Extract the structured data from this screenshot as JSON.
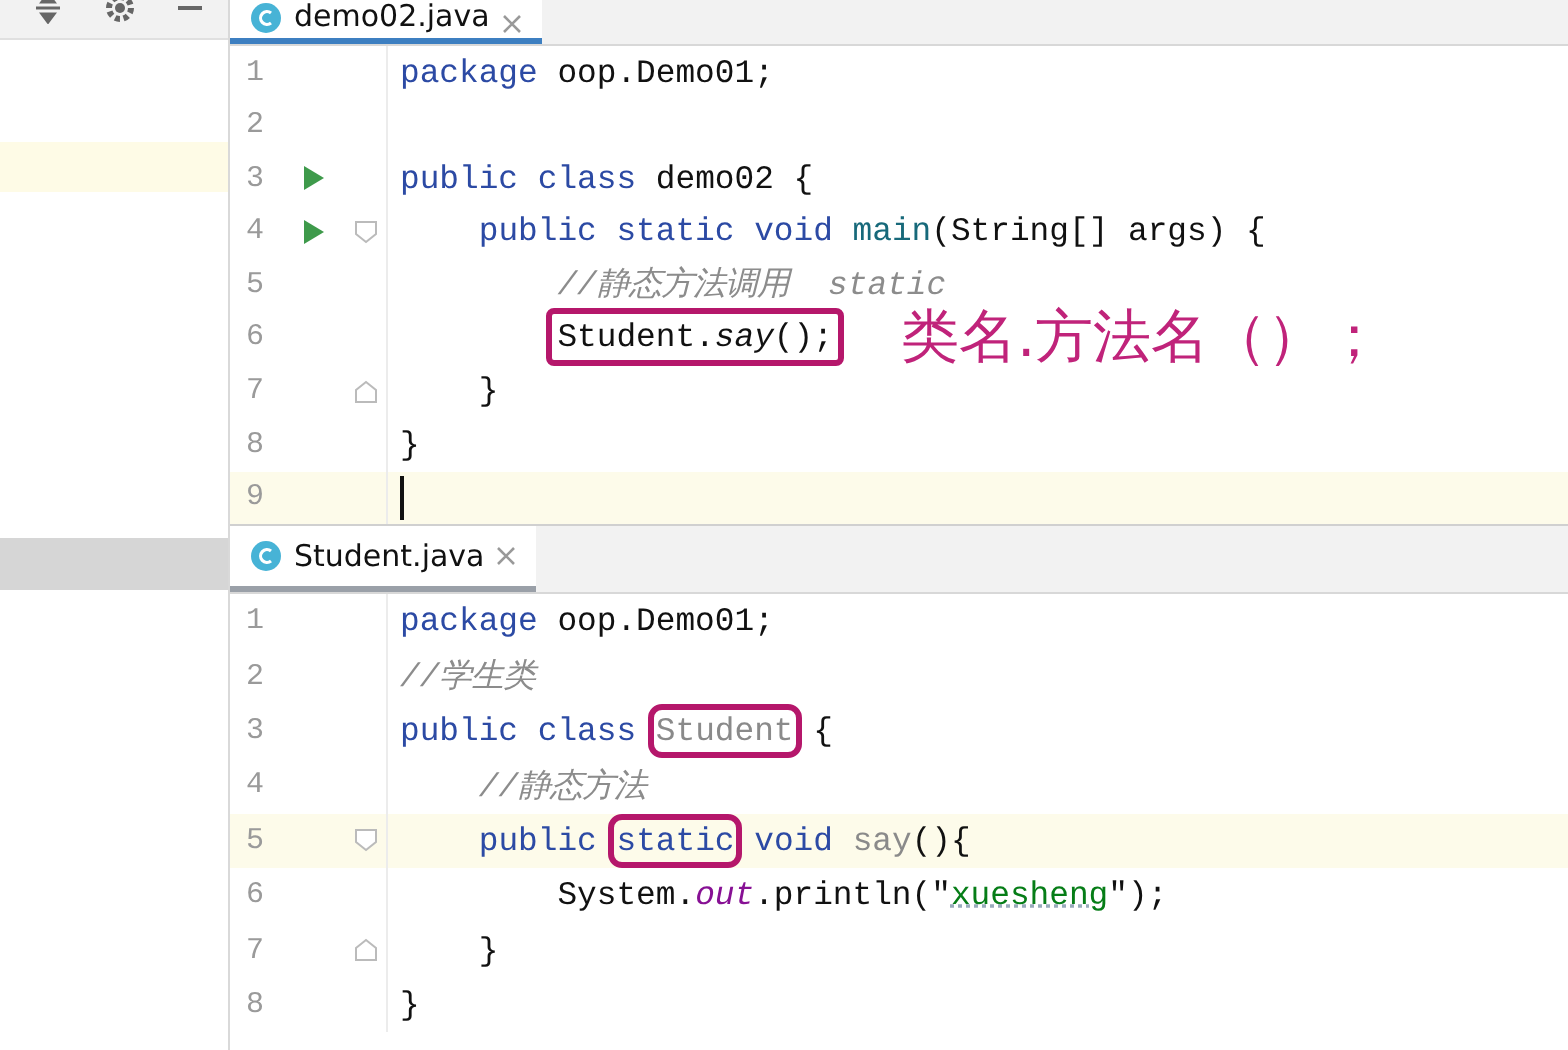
{
  "editors": [
    {
      "tab": {
        "label": "demo02.java",
        "selected": true
      },
      "lines": [
        {
          "number": "1",
          "tokens": [
            {
              "kind": "keyword",
              "text": "package"
            },
            {
              "kind": "plain",
              "text": " oop.Demo01;"
            }
          ]
        },
        {
          "number": "2"
        },
        {
          "number": "3",
          "run": true,
          "tokens": [
            {
              "kind": "keyword",
              "text": "public class"
            },
            {
              "kind": "plain",
              "text": " demo02 {"
            }
          ]
        },
        {
          "number": "4",
          "run": true,
          "fold_start": true,
          "tokens": [
            {
              "kind": "keyword",
              "text": "    public static void"
            },
            {
              "kind": "method",
              "text": " main"
            },
            {
              "kind": "plain",
              "text": "(String[] args) {"
            }
          ]
        },
        {
          "number": "5",
          "tokens": [
            {
              "kind": "comment",
              "text": "        //静态方法调用  static"
            }
          ]
        },
        {
          "number": "6",
          "tokens": [
            {
              "kind": "frame",
              "tokens": [
                {
                  "kind": "plain",
                  "text": "        Student."
                },
                {
                  "kind": "static-call",
                  "text": "say"
                },
                {
                  "kind": "plain",
                  "text": "();"
                }
              ]
            }
          ],
          "note": "类名.方法名（）；"
        },
        {
          "number": "7",
          "fold_end": true,
          "tokens": [
            {
              "kind": "plain",
              "text": "    }"
            }
          ]
        },
        {
          "number": "8",
          "tokens": [
            {
              "kind": "plain",
              "text": "}"
            }
          ]
        },
        {
          "number": "9",
          "current": true,
          "caret": true
        }
      ]
    },
    {
      "tab": {
        "label": "Student.java",
        "selected": false
      },
      "lines": [
        {
          "number": "1",
          "tokens": [
            {
              "kind": "keyword",
              "text": "package"
            },
            {
              "kind": "plain",
              "text": " oop.Demo01;"
            }
          ]
        },
        {
          "number": "2",
          "tokens": [
            {
              "kind": "comment",
              "text": "//学生类"
            }
          ]
        },
        {
          "number": "3",
          "tokens": [
            {
              "kind": "keyword",
              "text": "public class"
            },
            {
              "kind": "unused",
              "text": " Student",
              "boxed": true
            },
            {
              "kind": "plain",
              "text": " {"
            }
          ]
        },
        {
          "number": "4",
          "tokens": [
            {
              "kind": "comment",
              "text": "    //静态方法"
            }
          ]
        },
        {
          "number": "5",
          "current": true,
          "fold_start": true,
          "tokens": [
            {
              "kind": "keyword",
              "text": "    public"
            },
            {
              "kind": "keyword",
              "text": " static",
              "boxed": true
            },
            {
              "kind": "keyword",
              "text": " void"
            },
            {
              "kind": "unused",
              "text": " say"
            },
            {
              "kind": "plain",
              "text": "(){"
            }
          ]
        },
        {
          "number": "6",
          "tokens": [
            {
              "kind": "plain",
              "text": "        System."
            },
            {
              "kind": "static-field",
              "text": "out"
            },
            {
              "kind": "plain",
              "text": ".println(\""
            },
            {
              "kind": "string",
              "text": "xuesheng"
            },
            {
              "kind": "plain",
              "text": "\");"
            }
          ]
        },
        {
          "number": "7",
          "fold_end": true,
          "tokens": [
            {
              "kind": "plain",
              "text": "    }"
            }
          ]
        },
        {
          "number": "8",
          "tokens": [
            {
              "kind": "plain",
              "text": "}"
            }
          ]
        }
      ]
    }
  ]
}
